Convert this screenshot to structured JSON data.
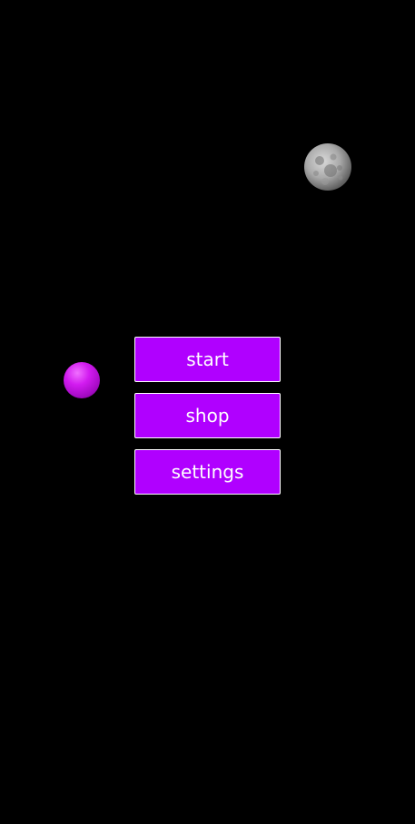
{
  "scene": {
    "background_color": "#000000",
    "moon_icon": "moon-icon",
    "ball_icon": "purple-ball-icon"
  },
  "menu": {
    "accent_color": "#b000ff",
    "start_label": "start",
    "shop_label": "shop",
    "settings_label": "settings"
  }
}
